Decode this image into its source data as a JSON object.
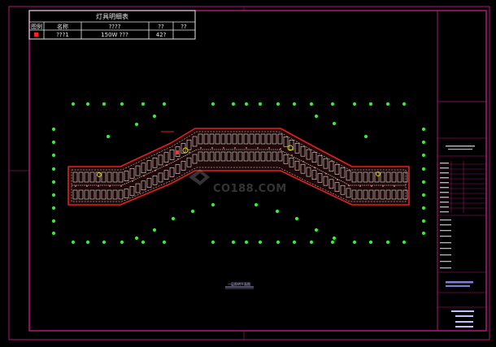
{
  "legend_table": {
    "title": "灯具明细表",
    "headers": [
      "图例",
      "名称",
      "????",
      "??",
      "??"
    ],
    "row": {
      "col2": "???1",
      "col3": "150W ???",
      "col4": "42?",
      "col5": ""
    }
  },
  "plan_caption": "一层照明平面图",
  "watermark": "CO188.COM",
  "colors": {
    "frame": "#b0187a",
    "building": "#e02020",
    "light": "#33ee33",
    "table_border": "#e8e8e8",
    "legend_symbol": "#ff2020"
  }
}
